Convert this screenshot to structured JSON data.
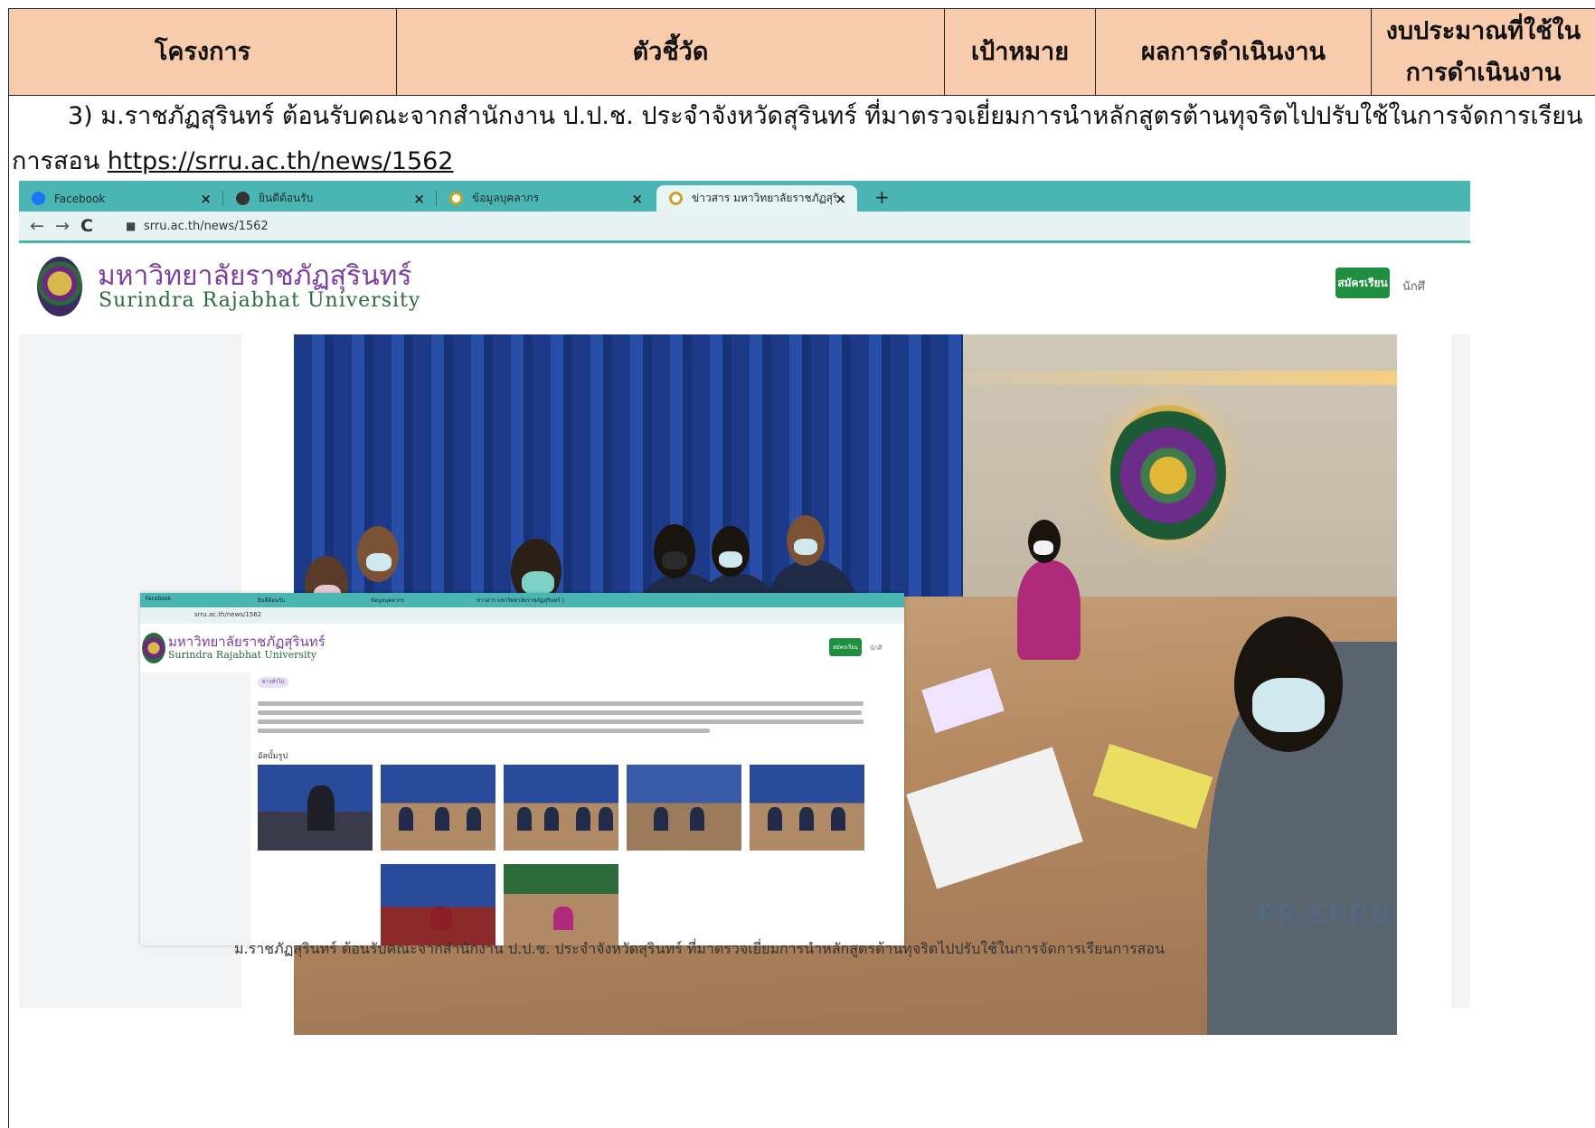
{
  "table": {
    "headers": [
      "โครงการ",
      "ตัวชี้วัด",
      "เป้าหมาย",
      "ผลการดำเนินงาน",
      "งบประมาณที่ใช้ใน การดำเนินงาน"
    ],
    "body_text": "3) ม.ราชภัฏสุรินทร์ ต้อนรับคณะจากสำนักงาน ป.ป.ช. ประจำจังหวัดสุรินทร์ ที่มาตรวจเยี่ยมการนำหลักสูตรต้านทุจริตไปปรับใช้ในการจัดการเรียนการสอน",
    "link": "https://srru.ac.th/news/1562"
  },
  "browser": {
    "tabs": [
      {
        "label": "Facebook",
        "icon": "facebook-icon",
        "color": "#1877f2"
      },
      {
        "label": "ยินดีต้อนรับ",
        "icon": "globe-icon",
        "color": "#333333"
      },
      {
        "label": "ข้อมูลบุคลากร",
        "icon": "site-favicon",
        "color": "#c9a227"
      },
      {
        "label": "ข่าวสาร มหาวิทยาลัยราชภัฏสุรินทร์ | S",
        "icon": "site-favicon",
        "color": "#c9a227"
      }
    ],
    "new_tab": "+",
    "url": "srru.ac.th/news/1562"
  },
  "site": {
    "name_th": "มหาวิทยาลัยราชภัฏสุรินทร์",
    "name_en": "Surindra Rajabhat University",
    "apply_button": "สมัครเรียน",
    "nav_cut": "นักศึ",
    "photo_watermark": "PR.SRRU",
    "caption": "ม.ราชภัฏสุรินทร์ ต้อนรับคณะจากสำนักงาน ป.ป.ช. ประจำจังหวัดสุรินทร์ ที่มาตรวจเยี่ยมการนำหลักสูตรต้านทุจริตไปปรับใช้ในการจัดการเรียนการสอน"
  },
  "inset": {
    "tabs": [
      "Facebook",
      "ยินดีต้อนรับ",
      "ข้อมูลบุคลากร",
      "ข่าวสาร มหาวิทยาลัยราชภัฏสุรินทร์ |"
    ],
    "url": "srru.ac.th/news/1562",
    "name_th": "มหาวิทยาลัยราชภัฏสุรินทร์",
    "name_en": "Surindra Rajabhat University",
    "apply_button": "สมัครเรียน",
    "nav_cut": "นักศึ",
    "tag": "ข่าวทั่วไป",
    "album_title": "อัลบั้มรูป"
  },
  "colors": {
    "header_fill": "#f8cbad",
    "tabbar": "#4bb5b3",
    "university_purple": "#7d3ea0",
    "university_green": "#2d6a3f",
    "apply_button": "#1f8e3e"
  }
}
